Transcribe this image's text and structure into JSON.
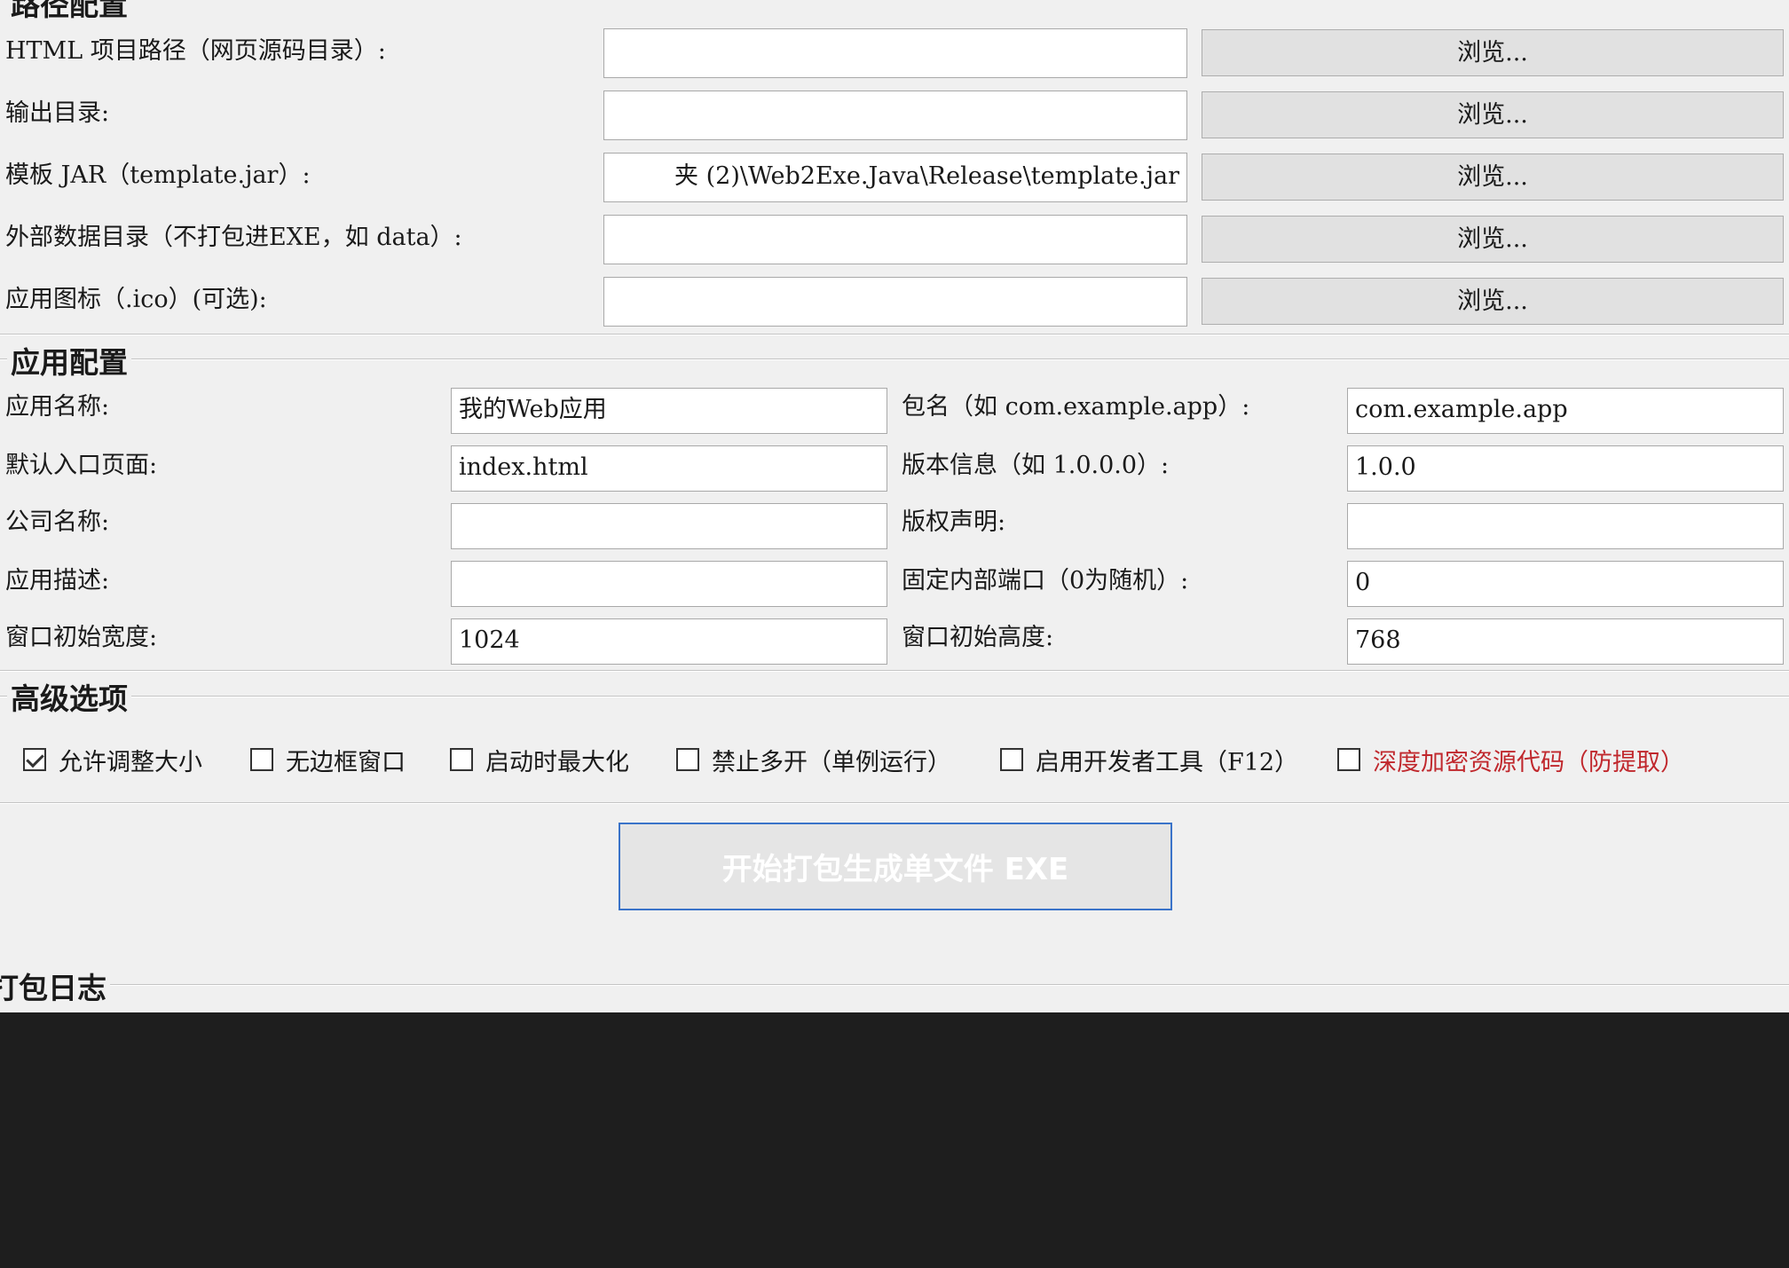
{
  "path_section": {
    "title": "路径配置",
    "rows": [
      {
        "label": "HTML 项目路径（网页源码目录）:",
        "value": "",
        "button": "浏览..."
      },
      {
        "label": "输出目录:",
        "value": "",
        "button": "浏览..."
      },
      {
        "label": "模板 JAR（template.jar）:",
        "value": "夹 (2)\\Web2Exe.Java\\Release\\template.jar",
        "button": "浏览..."
      },
      {
        "label": "外部数据目录（不打包进EXE，如 data）:",
        "value": "",
        "button": "浏览..."
      },
      {
        "label": "应用图标（.ico）(可选):",
        "value": "",
        "button": "浏览..."
      }
    ]
  },
  "app_section": {
    "title": "应用配置",
    "left": [
      {
        "label": "应用名称:",
        "value": "我的Web应用"
      },
      {
        "label": "默认入口页面:",
        "value": "index.html"
      },
      {
        "label": "公司名称:",
        "value": ""
      },
      {
        "label": "应用描述:",
        "value": ""
      },
      {
        "label": "窗口初始宽度:",
        "value": "1024"
      }
    ],
    "right": [
      {
        "label": "包名（如 com.example.app）:",
        "value": "com.example.app"
      },
      {
        "label": "版本信息（如 1.0.0.0）:",
        "value": "1.0.0"
      },
      {
        "label": "版权声明:",
        "value": ""
      },
      {
        "label": "固定内部端口（0为随机）:",
        "value": "0"
      },
      {
        "label": "窗口初始高度:",
        "value": "768"
      }
    ]
  },
  "advanced_section": {
    "title": "高级选项",
    "options": [
      {
        "label": "允许调整大小",
        "checked": true
      },
      {
        "label": "无边框窗口",
        "checked": false
      },
      {
        "label": "启动时最大化",
        "checked": false
      },
      {
        "label": "禁止多开（单例运行）",
        "checked": false
      },
      {
        "label": "启用开发者工具（F12）",
        "checked": false
      },
      {
        "label": "深度加密资源代码（防提取）",
        "checked": false,
        "highlight_color": "#c0282d"
      }
    ]
  },
  "build_button": {
    "label": "开始打包生成单文件 EXE"
  },
  "log_section": {
    "title": "打包日志"
  }
}
